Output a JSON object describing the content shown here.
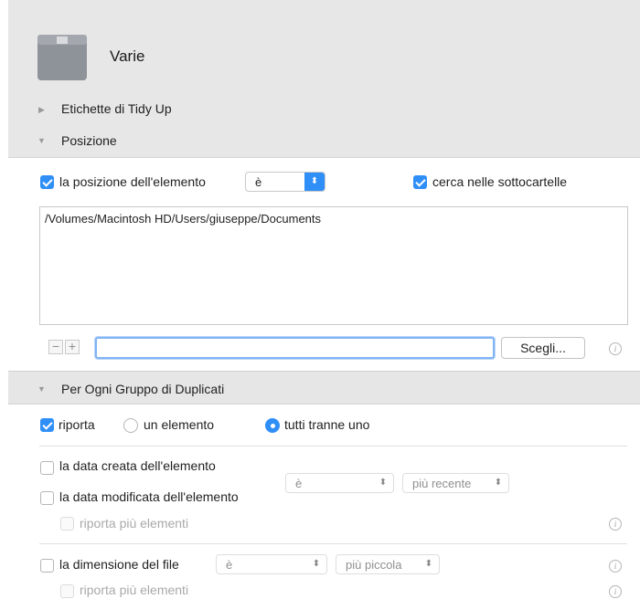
{
  "header": {
    "title": "Varie",
    "icon": "box-icon"
  },
  "groups": {
    "tidy_up_labels": "Etichette di Tidy Up",
    "position": "Posizione",
    "duplicates": "Per Ogni Gruppo di Duplicati"
  },
  "position": {
    "location_label": "la posizione dell'elemento",
    "location_checked": true,
    "operator_value": "è",
    "subfolders_label": "cerca nelle sottocartelle",
    "subfolders_checked": true,
    "paths_text": "/Volumes/Macintosh HD/Users/giuseppe/Documents",
    "path_input_value": "",
    "remove_label": "−",
    "add_label": "+",
    "choose_button": "Scegli..."
  },
  "duplicates": {
    "report_label": "riporta",
    "report_checked": true,
    "option_one": "un elemento",
    "option_all_but_one": "tutti tranne uno",
    "selected_option": "tutti tranne uno",
    "created_date_label": "la data creata dell'elemento",
    "modified_date_label": "la data modificata dell'elemento",
    "date_operator": "è",
    "date_value": "più recente",
    "report_more_label_1": "riporta più elementi",
    "file_size_label": "la dimensione del file",
    "size_operator": "è",
    "size_value": "più piccola",
    "report_more_label_2": "riporta più elementi"
  },
  "colors": {
    "accent": "#2f8ff7",
    "panel": "#e7e7e7",
    "section": "#ffffff"
  }
}
